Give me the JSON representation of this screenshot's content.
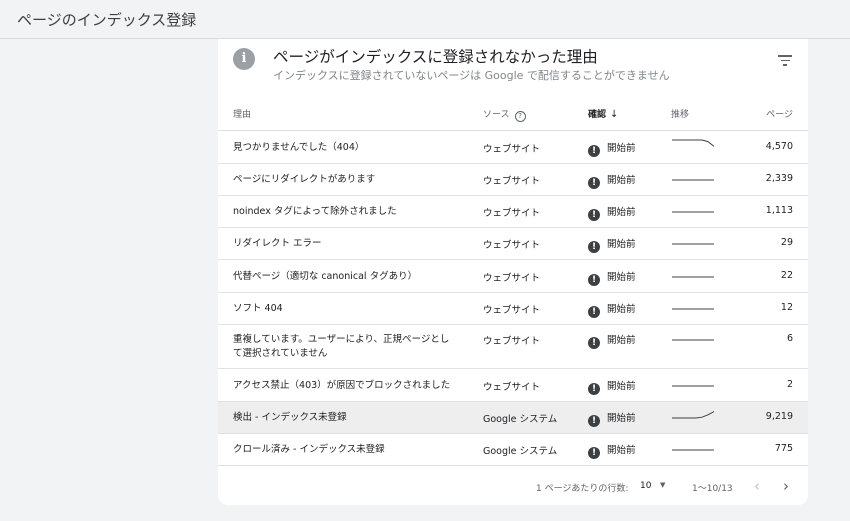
{
  "page": {
    "title": "ページのインデックス登録"
  },
  "card": {
    "title": "ページがインデックスに登録されなかった理由",
    "subtitle": "インデックスに登録されていないページは Google で配信することができません",
    "info_icon": "info-icon",
    "filter_icon": "filter-icon"
  },
  "table": {
    "headers": {
      "reason": "理由",
      "source": "ソース",
      "validation": "確認",
      "trend": "推移",
      "pages": "ページ"
    },
    "sort": {
      "column": "validation",
      "direction": "descending"
    },
    "rows": [
      {
        "reason": "見つかりませんでした（404）",
        "source": "ウェブサイト",
        "status": "開始前",
        "pages": "4,570",
        "trend": [
          1,
          1,
          1,
          1,
          1,
          1,
          0.9,
          0.6
        ]
      },
      {
        "reason": "ページにリダイレクトがあります",
        "source": "ウェブサイト",
        "status": "開始前",
        "pages": "2,339",
        "trend": [
          0.5,
          0.5,
          0.5,
          0.5,
          0.5,
          0.5,
          0.5,
          0.5
        ]
      },
      {
        "reason": "noindex タグによって除外されました",
        "source": "ウェブサイト",
        "status": "開始前",
        "pages": "1,113",
        "trend": [
          0.5,
          0.5,
          0.5,
          0.5,
          0.5,
          0.5,
          0.5,
          0.5
        ]
      },
      {
        "reason": "リダイレクト エラー",
        "source": "ウェブサイト",
        "status": "開始前",
        "pages": "29",
        "trend": [
          0.5,
          0.5,
          0.5,
          0.5,
          0.5,
          0.5,
          0.5,
          0.5
        ]
      },
      {
        "reason": "代替ページ（適切な canonical タグあり）",
        "source": "ウェブサイト",
        "status": "開始前",
        "pages": "22",
        "trend": [
          0.5,
          0.5,
          0.5,
          0.5,
          0.5,
          0.5,
          0.5,
          0.5
        ]
      },
      {
        "reason": "ソフト 404",
        "source": "ウェブサイト",
        "status": "開始前",
        "pages": "12",
        "trend": [
          0.5,
          0.5,
          0.5,
          0.5,
          0.5,
          0.5,
          0.5,
          0.5
        ]
      },
      {
        "reason": "重複しています。ユーザーにより、正規ページとして選択されていません",
        "source": "ウェブサイト",
        "status": "開始前",
        "pages": "6",
        "trend": [
          0.5,
          0.5,
          0.5,
          0.5,
          0.5,
          0.5,
          0.5,
          0.5
        ]
      },
      {
        "reason": "アクセス禁止（403）が原因でブロックされました",
        "source": "ウェブサイト",
        "status": "開始前",
        "pages": "2",
        "trend": [
          0.5,
          0.5,
          0.5,
          0.5,
          0.5,
          0.5,
          0.5,
          0.5
        ]
      },
      {
        "reason": "検出 - インデックス未登録",
        "source": "Google システム",
        "status": "開始前",
        "pages": "9,219",
        "trend": [
          0.5,
          0.5,
          0.5,
          0.5,
          0.5,
          0.55,
          0.7,
          0.9
        ]
      },
      {
        "reason": "クロール済み - インデックス未登録",
        "source": "Google システム",
        "status": "開始前",
        "pages": "775",
        "trend": [
          0.5,
          0.5,
          0.5,
          0.5,
          0.5,
          0.5,
          0.5,
          0.5
        ]
      }
    ]
  },
  "pagination": {
    "rows_per_page_label": "1 ページあたりの行数:",
    "rows_per_page_value": "10",
    "range_label": "1〜10/13"
  },
  "colors": {
    "background": "#f1f3f4",
    "card": "#ffffff",
    "status_icon": "#3c4043",
    "sparkline": "#3c4043",
    "highlight_row": "#eeeeee"
  }
}
